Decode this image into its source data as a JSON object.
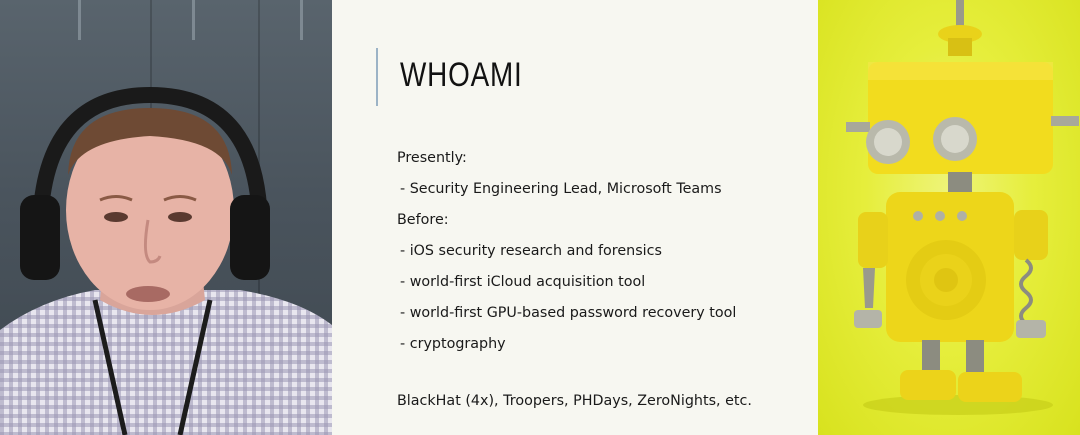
{
  "slide": {
    "title": "WHOAMI",
    "lines": [
      {
        "text": "Presently:",
        "type": "heading"
      },
      {
        "text": "- Security Engineering Lead, Microsoft Teams",
        "type": "bullet"
      },
      {
        "text": "Before:",
        "type": "heading"
      },
      {
        "text": "- iOS security research and forensics",
        "type": "bullet"
      },
      {
        "text": "- world-first iCloud acquisition tool",
        "type": "bullet"
      },
      {
        "text": "- world-first GPU-based password recovery tool",
        "type": "bullet"
      },
      {
        "text": "- cryptography",
        "type": "bullet"
      }
    ],
    "footer": "BlackHat (4x), Troopers, PHDays, ZeroNights, etc."
  },
  "colors": {
    "slide_bg": "#f7f7f1",
    "title_rule": "#9cb3c6",
    "robot_bg": "#e6ee3c",
    "robot_body": "#f2dc1e"
  }
}
